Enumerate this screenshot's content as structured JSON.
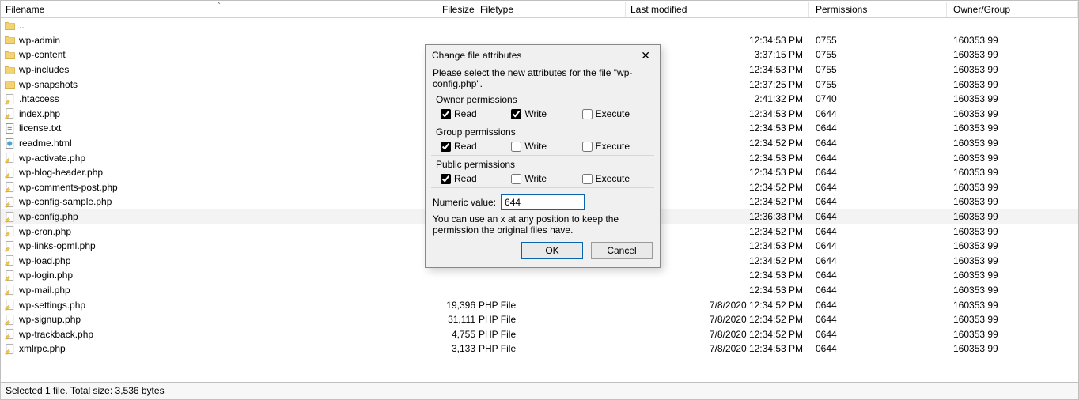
{
  "columns": {
    "filename": "Filename",
    "filesize": "Filesize",
    "filetype": "Filetype",
    "modified": "Last modified",
    "permissions": "Permissions",
    "owner": "Owner/Group"
  },
  "files": [
    {
      "icon": "folder",
      "name": "..",
      "size": "",
      "type": "",
      "mod": "",
      "perm": "",
      "owner": "",
      "sel": false
    },
    {
      "icon": "folder",
      "name": "wp-admin",
      "size": "",
      "type": "",
      "mod": "12:34:53 PM",
      "perm": "0755",
      "owner": "160353 99"
    },
    {
      "icon": "folder",
      "name": "wp-content",
      "size": "",
      "type": "",
      "mod": "3:37:15 PM",
      "perm": "0755",
      "owner": "160353 99"
    },
    {
      "icon": "folder",
      "name": "wp-includes",
      "size": "",
      "type": "",
      "mod": "12:34:53 PM",
      "perm": "0755",
      "owner": "160353 99"
    },
    {
      "icon": "folder",
      "name": "wp-snapshots",
      "size": "",
      "type": "",
      "mod": "12:37:25 PM",
      "perm": "0755",
      "owner": "160353 99"
    },
    {
      "icon": "php",
      "name": ".htaccess",
      "size": "",
      "type": "",
      "mod": "2:41:32 PM",
      "perm": "0740",
      "owner": "160353 99"
    },
    {
      "icon": "php",
      "name": "index.php",
      "size": "",
      "type": "",
      "mod": "12:34:53 PM",
      "perm": "0644",
      "owner": "160353 99"
    },
    {
      "icon": "txt",
      "name": "license.txt",
      "size": "",
      "type": "",
      "mod": "12:34:53 PM",
      "perm": "0644",
      "owner": "160353 99"
    },
    {
      "icon": "html",
      "name": "readme.html",
      "size": "",
      "type": "",
      "mod": "12:34:52 PM",
      "perm": "0644",
      "owner": "160353 99"
    },
    {
      "icon": "php",
      "name": "wp-activate.php",
      "size": "",
      "type": "",
      "mod": "12:34:53 PM",
      "perm": "0644",
      "owner": "160353 99"
    },
    {
      "icon": "php",
      "name": "wp-blog-header.php",
      "size": "",
      "type": "",
      "mod": "12:34:53 PM",
      "perm": "0644",
      "owner": "160353 99"
    },
    {
      "icon": "php",
      "name": "wp-comments-post.php",
      "size": "",
      "type": "",
      "mod": "12:34:52 PM",
      "perm": "0644",
      "owner": "160353 99"
    },
    {
      "icon": "php",
      "name": "wp-config-sample.php",
      "size": "",
      "type": "",
      "mod": "12:34:52 PM",
      "perm": "0644",
      "owner": "160353 99"
    },
    {
      "icon": "php",
      "name": "wp-config.php",
      "size": "",
      "type": "",
      "mod": "12:36:38 PM",
      "perm": "0644",
      "owner": "160353 99",
      "sel": true
    },
    {
      "icon": "php",
      "name": "wp-cron.php",
      "size": "",
      "type": "",
      "mod": "12:34:52 PM",
      "perm": "0644",
      "owner": "160353 99"
    },
    {
      "icon": "php",
      "name": "wp-links-opml.php",
      "size": "",
      "type": "",
      "mod": "12:34:53 PM",
      "perm": "0644",
      "owner": "160353 99"
    },
    {
      "icon": "php",
      "name": "wp-load.php",
      "size": "",
      "type": "",
      "mod": "12:34:52 PM",
      "perm": "0644",
      "owner": "160353 99"
    },
    {
      "icon": "php",
      "name": "wp-login.php",
      "size": "",
      "type": "",
      "mod": "12:34:53 PM",
      "perm": "0644",
      "owner": "160353 99"
    },
    {
      "icon": "php",
      "name": "wp-mail.php",
      "size": "",
      "type": "",
      "mod": "12:34:53 PM",
      "perm": "0644",
      "owner": "160353 99"
    },
    {
      "icon": "php",
      "name": "wp-settings.php",
      "size": "19,396",
      "type": "PHP File",
      "mod": "7/8/2020 12:34:52 PM",
      "perm": "0644",
      "owner": "160353 99"
    },
    {
      "icon": "php",
      "name": "wp-signup.php",
      "size": "31,111",
      "type": "PHP File",
      "mod": "7/8/2020 12:34:52 PM",
      "perm": "0644",
      "owner": "160353 99"
    },
    {
      "icon": "php",
      "name": "wp-trackback.php",
      "size": "4,755",
      "type": "PHP File",
      "mod": "7/8/2020 12:34:52 PM",
      "perm": "0644",
      "owner": "160353 99"
    },
    {
      "icon": "php",
      "name": "xmlrpc.php",
      "size": "3,133",
      "type": "PHP File",
      "mod": "7/8/2020 12:34:53 PM",
      "perm": "0644",
      "owner": "160353 99"
    }
  ],
  "status": "Selected 1 file. Total size: 3,536 bytes",
  "dialog": {
    "title": "Change file attributes",
    "instruction": "Please select the new attributes for the file \"wp-config.php\".",
    "groups": {
      "owner": {
        "title": "Owner permissions",
        "read": true,
        "write": true,
        "execute": false
      },
      "group": {
        "title": "Group permissions",
        "read": true,
        "write": false,
        "execute": false
      },
      "public": {
        "title": "Public permissions",
        "read": true,
        "write": false,
        "execute": false
      }
    },
    "labels": {
      "read": "Read",
      "write": "Write",
      "execute": "Execute"
    },
    "numeric_label": "Numeric value:",
    "numeric_value": "644",
    "hint": "You can use an x at any position to keep the permission the original files have.",
    "ok": "OK",
    "cancel": "Cancel"
  }
}
